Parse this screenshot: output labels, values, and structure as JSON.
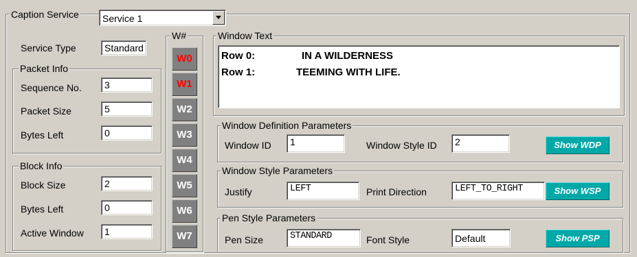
{
  "caption_service": {
    "label": "Caption Service",
    "selected": "Service 1"
  },
  "service_type": {
    "label": "Service Type",
    "value": "Standard"
  },
  "packet_info": {
    "title": "Packet Info",
    "sequence_label": "Sequence No.",
    "sequence_value": "3",
    "packet_size_label": "Packet Size",
    "packet_size_value": "5",
    "bytes_left_label": "Bytes Left",
    "bytes_left_value": "0"
  },
  "block_info": {
    "title": "Block Info",
    "block_size_label": "Block Size",
    "block_size_value": "2",
    "bytes_left_label": "Bytes Left",
    "bytes_left_value": "0",
    "active_window_label": "Active Window",
    "active_window_value": "1"
  },
  "windows": {
    "title": "W#",
    "buttons": [
      "W0",
      "W1",
      "W2",
      "W3",
      "W4",
      "W5",
      "W6",
      "W7"
    ],
    "active_color": "#ff0000",
    "inactive_color": "#ffffff"
  },
  "window_text": {
    "title": "Window Text",
    "rows": [
      {
        "label": "Row 0:",
        "text": "IN A WILDERNESS"
      },
      {
        "label": "Row 1:",
        "text": "TEEMING WITH LIFE."
      }
    ]
  },
  "wdp": {
    "title": "Window Definition Parameters",
    "window_id_label": "Window ID",
    "window_id_value": "1",
    "style_id_label": "Window Style ID",
    "style_id_value": "2",
    "show_label": "Show WDP"
  },
  "wsp": {
    "title": "Window Style Parameters",
    "justify_label": "Justify",
    "justify_value": "LEFT",
    "print_dir_label": "Print Direction",
    "print_dir_value": "LEFT_TO_RIGHT",
    "show_label": "Show WSP"
  },
  "psp": {
    "title": "Pen Style Parameters",
    "pen_size_label": "Pen Size",
    "pen_size_value": "STANDARD",
    "font_style_label": "Font Style",
    "font_style_value": "Default",
    "show_label": "Show PSP"
  },
  "colors": {
    "background": "#d4d0c8",
    "button_gray": "#808080",
    "show_button": "#00a8a8"
  }
}
